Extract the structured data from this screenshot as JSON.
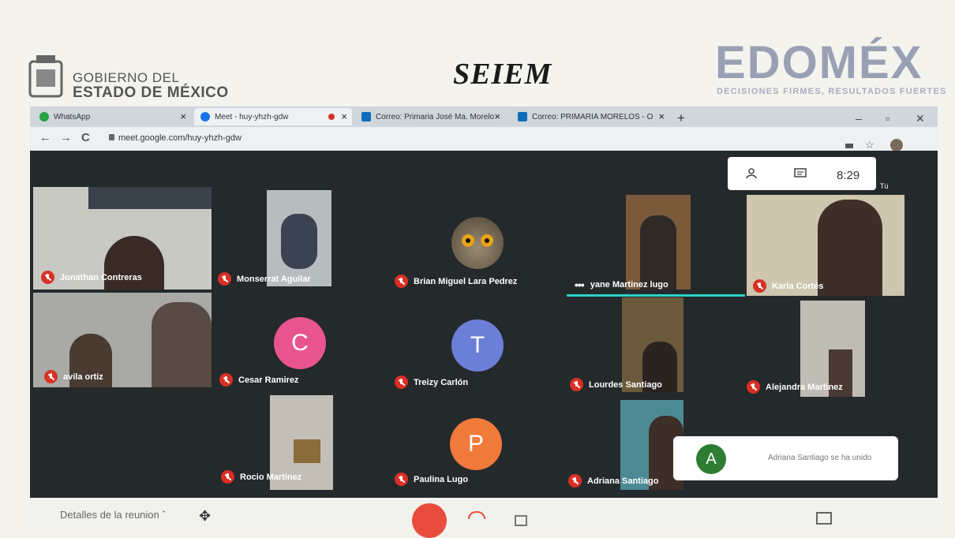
{
  "header": {
    "gov_line1": "GOBIERNO DEL",
    "gov_line2": "ESTADO DE MÉXICO",
    "seiem": "SEIEM",
    "edomex": "EDOMÉX",
    "edomex_tagline": "DECISIONES FIRMES, RESULTADOS FUERTES"
  },
  "browser": {
    "tabs": [
      {
        "label": "WhatsApp",
        "icon": "whatsapp-icon",
        "color": "#25a244"
      },
      {
        "label": "Meet - huy-yhzh-gdw",
        "icon": "meet-icon",
        "color": "#1a73e8"
      },
      {
        "label": "Correo: Primaria José Ma. Morelo",
        "icon": "outlook-icon",
        "color": "#0f6cbd"
      },
      {
        "label": "Correo: PRIMARIA MORELOS - O",
        "icon": "outlook-icon",
        "color": "#0f6cbd"
      }
    ],
    "url": "meet.google.com/huy-yhzh-gdw"
  },
  "meet": {
    "time": "8:29",
    "self_label": "Tú",
    "participants": [
      {
        "name": "Jonathan Contreras"
      },
      {
        "name": "Monserrat Aguilar"
      },
      {
        "name": "Brian Miguel Lara Pedrez"
      },
      {
        "name": "yane Martinez lugo"
      },
      {
        "name": "Karla Cortés"
      },
      {
        "name": "avila ortiz"
      },
      {
        "name": "Cesar Ramirez",
        "initial": "C",
        "color": "#e8558e"
      },
      {
        "name": "Treizy Carlón",
        "initial": "T",
        "color": "#6b7fd8"
      },
      {
        "name": "Lourdes Santiago"
      },
      {
        "name": "Alejandra Martinez"
      },
      {
        "name": "Rocio Martinez"
      },
      {
        "name": "Paulina Lugo",
        "initial": "P",
        "color": "#f07a3a"
      },
      {
        "name": "Adriana Santiago"
      }
    ],
    "toast": {
      "initial": "A",
      "message": "Adriana Santiago se ha unido"
    }
  },
  "bottom": {
    "details": "Detalles de la reunion"
  }
}
